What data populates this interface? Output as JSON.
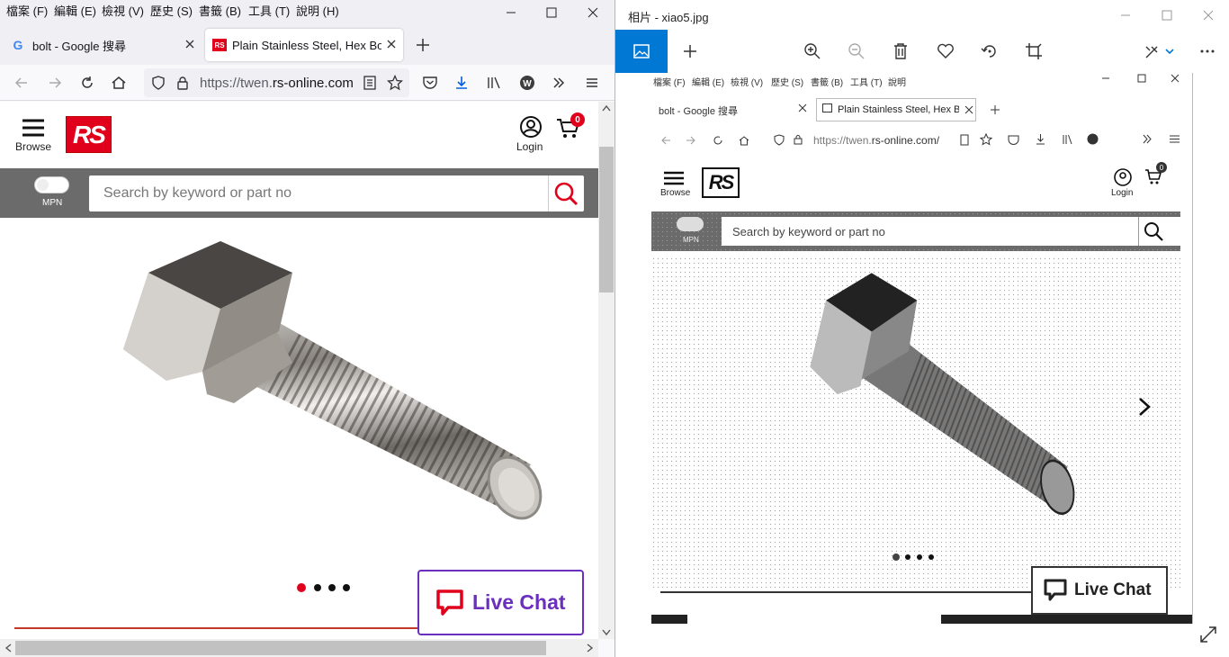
{
  "browser": {
    "menu": [
      "檔案 (F)",
      "編輯 (E)",
      "檢視 (V)",
      "歷史 (S)",
      "書籤 (B)",
      "工具 (T)",
      "說明 (H)"
    ],
    "tabs": [
      {
        "title": "bolt - Google 搜尋",
        "active": false
      },
      {
        "title": "Plain Stainless Steel, Hex Bolt,",
        "active": true
      }
    ],
    "url_prefix": "https://twen.",
    "url_domain": "rs-online.com"
  },
  "site": {
    "browse_label": "Browse",
    "logo_text": "RS",
    "login_label": "Login",
    "cart_count": "0",
    "mpn_label": "MPN",
    "search_placeholder": "Search by keyword or part no",
    "live_chat_label": "Live Chat",
    "carousel_active_index": 1,
    "carousel_count": 4
  },
  "photos": {
    "window_title": "相片 - xiao5.jpg",
    "menu": [
      "檔案 (F)",
      "編輯 (E)",
      "檢視 (V)",
      "歷史 (S)",
      "書籤 (B)",
      "工具 (T)",
      "說明"
    ],
    "tabs": [
      {
        "title": "bolt - Google 搜尋"
      },
      {
        "title": "Plain Stainless Steel, Hex Bolt"
      }
    ],
    "url_prefix": "https://twen.",
    "url_domain": "rs-online.com/",
    "browse_label": "Browse",
    "logo_text": "RS",
    "login_label": "Login",
    "cart_count": "0",
    "mpn_label": "MPN",
    "search_placeholder": "Search by keyword or part no",
    "live_chat_label": "Live Chat"
  },
  "colors": {
    "rs_red": "#e0001b",
    "chat_purple": "#6b2fbf",
    "photos_blue": "#0078d4",
    "gray_bar": "#6b6b6b"
  }
}
